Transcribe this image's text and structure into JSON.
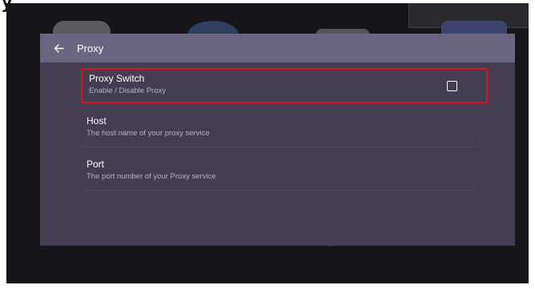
{
  "caption": "y",
  "background": {
    "dim_text": "Q"
  },
  "dialog": {
    "title": "Proxy",
    "back_icon": "arrow-left-icon",
    "items": [
      {
        "label": "Proxy Switch",
        "description": "Enable / Disable Proxy",
        "checked": false,
        "highlighted": true
      },
      {
        "label": "Host",
        "description": "The host name of your proxy service"
      },
      {
        "label": "Port",
        "description": "The port number of your Proxy service"
      }
    ]
  },
  "colors": {
    "titlebar": "#6c6582",
    "dialog_bg": "#453e52",
    "highlight": "#d8141e"
  }
}
